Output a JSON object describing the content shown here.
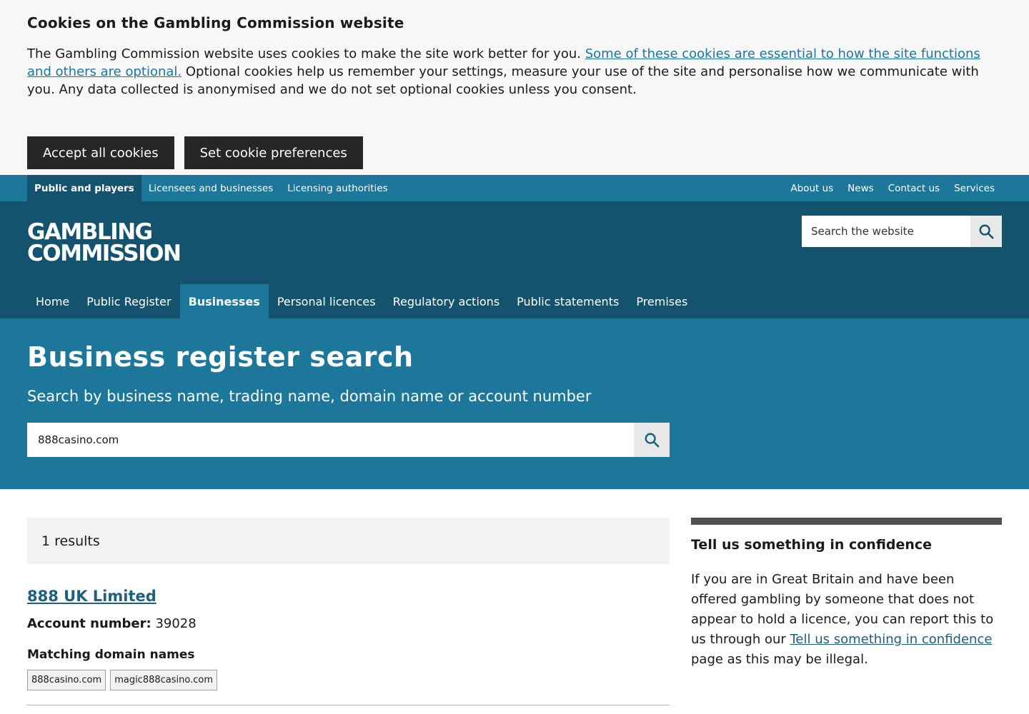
{
  "cookie": {
    "title": "Cookies on the Gambling Commission website",
    "text_before": "The Gambling Commission website uses cookies to make the site work better for you. ",
    "link_text": "Some of these cookies are essential to how the site functions and others are optional.",
    "text_after": " Optional cookies help us remember your settings, measure your use of the site and personalise how we communicate with you. Any data collected is anonymised and we do not set optional cookies unless you consent.",
    "accept_label": "Accept all cookies",
    "prefs_label": "Set cookie preferences"
  },
  "topnav": {
    "left": [
      "Public and players",
      "Licensees and businesses",
      "Licensing authorities"
    ],
    "right": [
      "About us",
      "News",
      "Contact us",
      "Services"
    ]
  },
  "header": {
    "logo_line1": "GAMBLING",
    "logo_line2": "COMMISSION",
    "search_placeholder": "Search the website"
  },
  "mainnav": [
    "Home",
    "Public Register",
    "Businesses",
    "Personal licences",
    "Regulatory actions",
    "Public statements",
    "Premises"
  ],
  "hero": {
    "title": "Business register search",
    "subtitle": "Search by business name, trading name, domain name or account number",
    "search_value": "888casino.com"
  },
  "results": {
    "count_label": "1 results",
    "business_name": "888 UK Limited",
    "account_label": "Account number:",
    "account_number": "39028",
    "domains_heading": "Matching domain names",
    "domains": [
      "888casino.com",
      "magic888casino.com"
    ]
  },
  "sidebar": {
    "title": "Tell us something in confidence",
    "text_before": "If you are in Great Britain and have been offered gambling by someone that does not appear to hold a licence, you can report this to us through our ",
    "link_text": "Tell us something in confidence",
    "text_after": " page as this may be illegal."
  },
  "colors": {
    "brand_dark": "#14536e",
    "brand": "#1d779b",
    "cookie_bg": "#f7f7f7",
    "link": "#1d5f7d"
  }
}
